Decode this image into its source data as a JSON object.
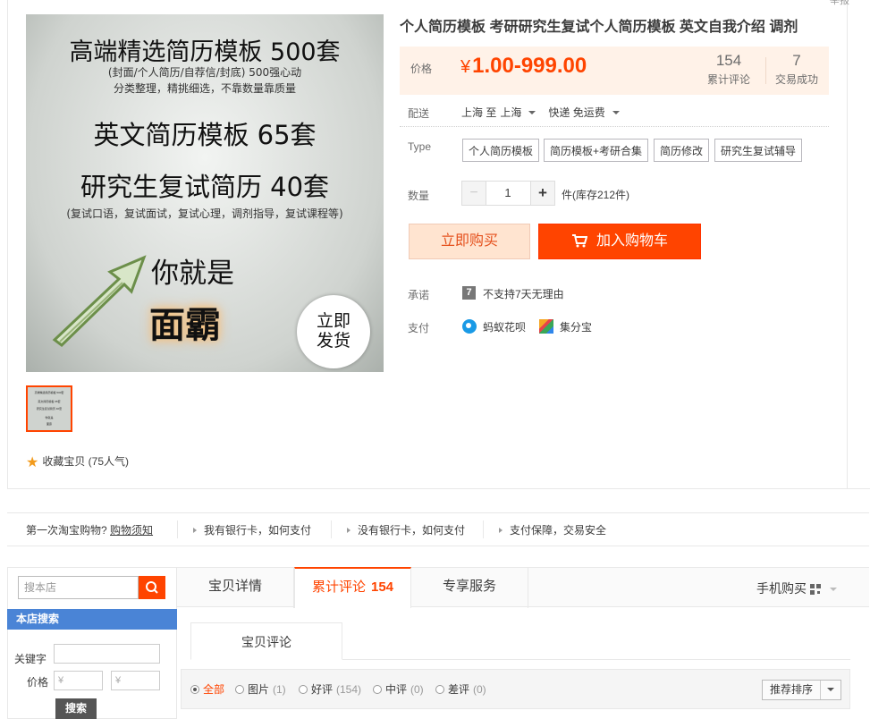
{
  "product": {
    "title": "个人简历模板 考研研究生复试个人简历模板 英文自我介绍 调剂",
    "image_text": {
      "line1": "高端精选简历模板 500套",
      "line2": "(封面/个人简历/自荐信/封底) 500强心动",
      "line3": "分类整理，精挑细选，不靠数量靠质量",
      "line4": "英文简历模板 65套",
      "line5": "研究生复试简历 40套",
      "line6": "(复试口语，复试面试，复试心理，调剂指导，复试课程等)",
      "line7": "你就是",
      "line8": "面霸",
      "badge_top": "立即",
      "badge_bottom": "发货"
    },
    "thumb_text": {
      "t1": "高端精选简历模板 500套",
      "t2": "英文简历模板 65套",
      "t3": "研究生复试简历 40套",
      "t4": "你就是",
      "t5": "面霸"
    },
    "favorite": "收藏宝贝 (75人气)",
    "top_cut_text": "举报"
  },
  "price": {
    "label": "价格",
    "currency": "¥",
    "value": "1.00-999.00",
    "stats": [
      {
        "num": "154",
        "label": "累计评论"
      },
      {
        "num": "7",
        "label": "交易成功"
      }
    ]
  },
  "shipping": {
    "label": "配送",
    "from": "上海 至",
    "to": "上海",
    "method": "快递 免运费"
  },
  "options": {
    "label": "Type",
    "items": [
      "个人简历模板",
      "简历模板+考研合集",
      "简历修改",
      "研究生复试辅导"
    ]
  },
  "quantity": {
    "label": "数量",
    "minus": "−",
    "value": "1",
    "plus": "+",
    "stock": "件(库存212件)"
  },
  "actions": {
    "buy_now": "立即购买",
    "add_cart": "加入购物车"
  },
  "promise": {
    "label": "承诺",
    "icon_text": "7",
    "text": "不支持7天无理由"
  },
  "payment": {
    "label": "支付",
    "methods": [
      "蚂蚁花呗",
      "集分宝"
    ]
  },
  "help_bar": {
    "first_text": "第一次淘宝购物?",
    "first_link": "购物须知",
    "items": [
      "我有银行卡，如何支付",
      "没有银行卡，如何支付",
      "支付保障，交易安全"
    ]
  },
  "sidebar": {
    "search_placeholder": "搜本店",
    "heading": "本店搜索",
    "keyword_label": "关键字",
    "price_label": "价格",
    "price_from_placeholder": "¥",
    "price_to_placeholder": "¥",
    "search_button": "搜索"
  },
  "tabs": {
    "items": [
      {
        "label": "宝贝详情"
      },
      {
        "label": "累计评论",
        "count": "154"
      },
      {
        "label": "专享服务"
      }
    ],
    "mobile_buy": "手机购买"
  },
  "reviews": {
    "subtab": "宝贝评论",
    "filters": [
      {
        "label": "全部",
        "count": ""
      },
      {
        "label": "图片",
        "count": "(1)"
      },
      {
        "label": "好评",
        "count": "(154)"
      },
      {
        "label": "中评",
        "count": "(0)"
      },
      {
        "label": "差评",
        "count": "(0)"
      }
    ],
    "sort_label": "推荐排序"
  },
  "colors": {
    "accent": "#ff4400",
    "price_bg": "#fff2e8",
    "sidebar_head": "#4a84d6"
  }
}
